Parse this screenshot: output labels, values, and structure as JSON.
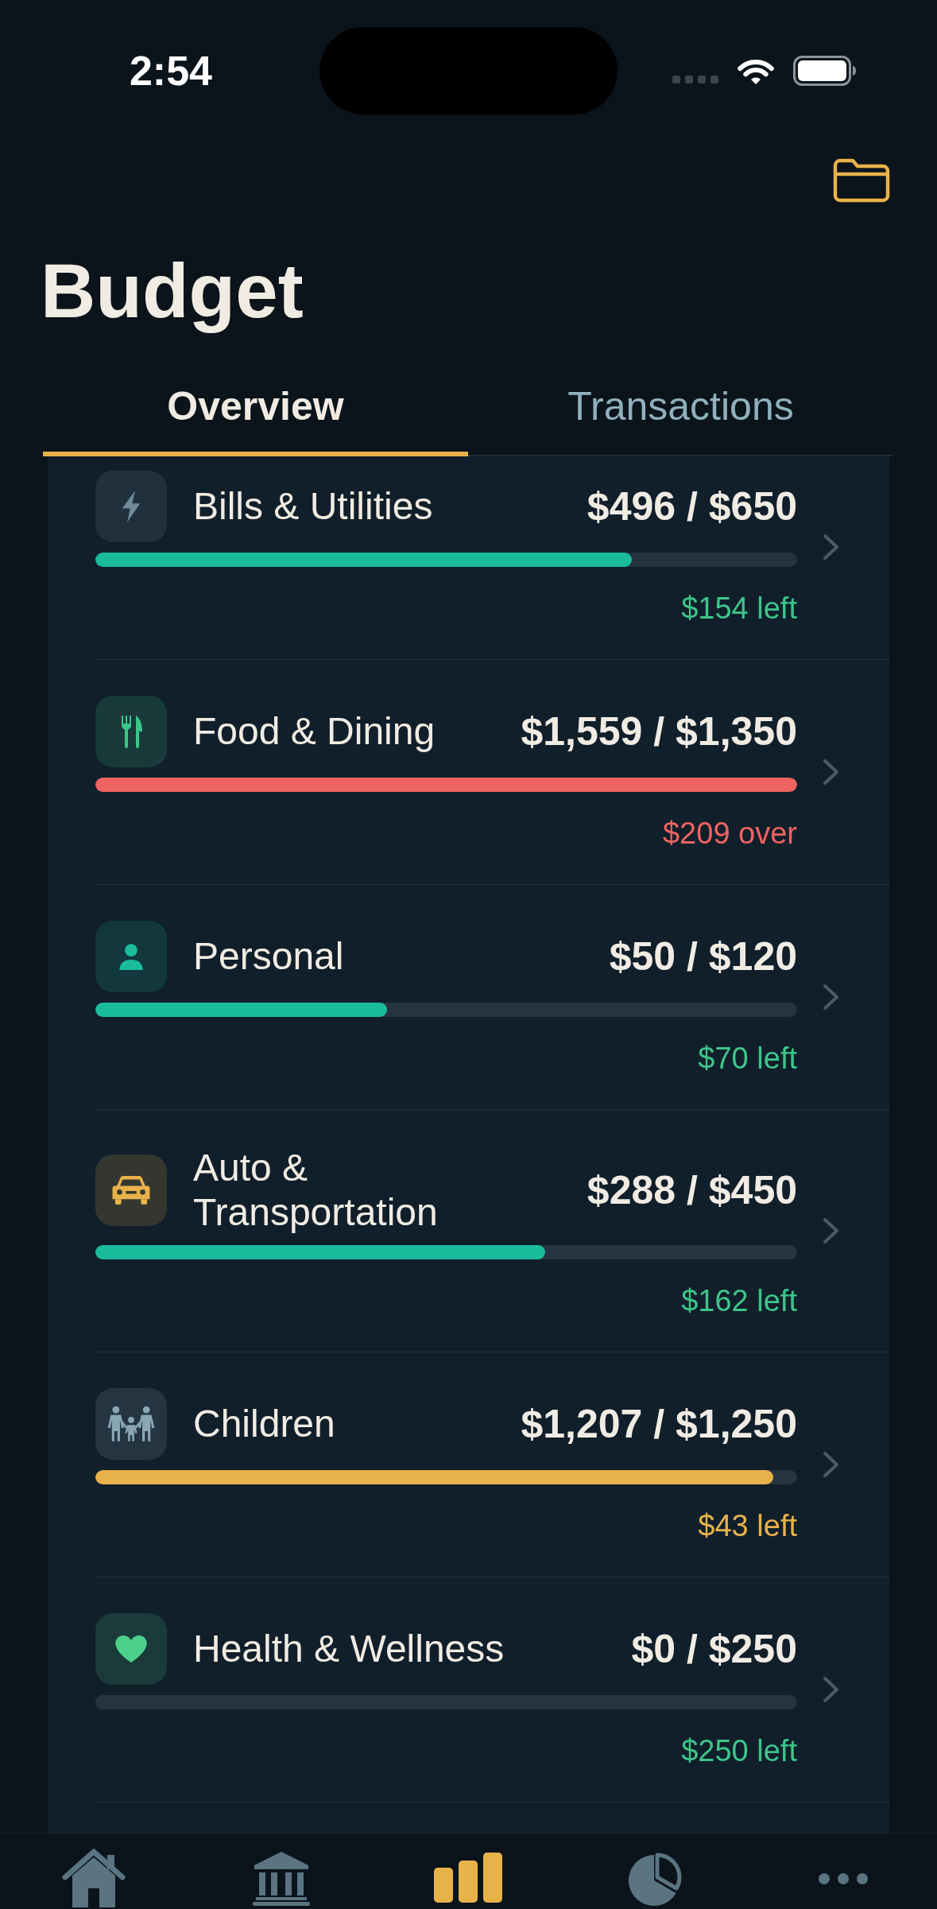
{
  "status_bar": {
    "time": "2:54"
  },
  "header": {
    "title": "Budget"
  },
  "tabs": [
    {
      "label": "Overview",
      "selected": true
    },
    {
      "label": "Transactions",
      "selected": false
    }
  ],
  "categories": [
    {
      "kind": "utilities",
      "name": "Bills & Utilities",
      "amount": "$496 / $650",
      "level": 0.764,
      "remark": "$154 left",
      "over_budget": false,
      "color": "#6f8b98"
    },
    {
      "kind": "food",
      "name": "Food & Dining",
      "amount": "$1,559 / $1,350",
      "level": 1,
      "remark": "$209 over",
      "over_budget": true,
      "color": "#3ec58a"
    },
    {
      "kind": "personal",
      "name": "Personal",
      "amount": "$50 / $120",
      "level": 0.416,
      "remark": "$70 left",
      "over_budget": false,
      "color": "#1abc9c"
    },
    {
      "kind": "auto",
      "name": "Auto & Transportation",
      "amount": "$288 / $450",
      "level": 0.641,
      "remark": "$162 left",
      "over_budget": false,
      "color": "#e8b24a"
    },
    {
      "kind": "children",
      "name": "Children",
      "amount": "$1,207 / $1,250",
      "level": 0.966,
      "remark": "$43 left",
      "over_budget": false,
      "color": "#8aa7b3"
    },
    {
      "kind": "health",
      "name": "Health & Wellness",
      "amount": "$0 / $250",
      "level": 0,
      "remark": "$250 left",
      "over_budget": false,
      "color": "#4ccf8a"
    }
  ],
  "bottom_nav": [
    {
      "kind": "home",
      "selected": false
    },
    {
      "kind": "bank",
      "selected": false
    },
    {
      "kind": "bars",
      "selected": true
    },
    {
      "kind": "pie",
      "selected": false
    },
    {
      "kind": "more",
      "selected": false
    }
  ]
}
